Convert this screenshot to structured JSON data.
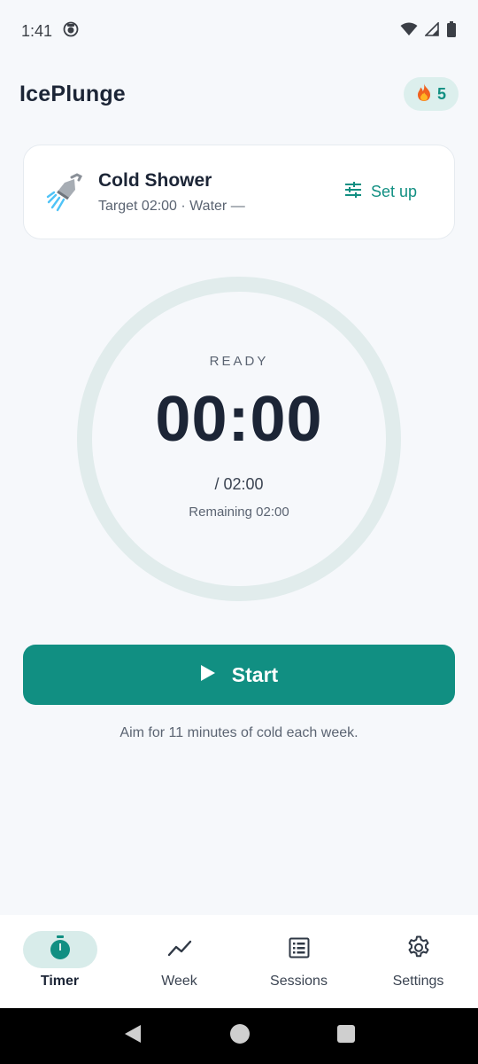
{
  "status_bar": {
    "time": "1:41",
    "icons": [
      "app-notification-icon",
      "wifi-icon",
      "signal-icon",
      "battery-icon"
    ]
  },
  "header": {
    "title": "IcePlunge",
    "streak_icon": "flame-icon",
    "streak_count": "5"
  },
  "mode_card": {
    "icon": "shower-icon",
    "title": "Cold Shower",
    "subtitle": "Target 02:00 · Water —",
    "setup_label": "Set up",
    "setup_icon": "tune-icon"
  },
  "timer": {
    "state": "READY",
    "time": "00:00",
    "target": "/ 02:00",
    "remaining": "Remaining 02:00"
  },
  "start_button": {
    "label": "Start",
    "icon": "play-icon"
  },
  "hint": "Aim for 11 minutes of cold each week.",
  "bottom_nav": {
    "items": [
      {
        "label": "Timer",
        "icon": "stopwatch-icon",
        "active": true
      },
      {
        "label": "Week",
        "icon": "trend-icon",
        "active": false
      },
      {
        "label": "Sessions",
        "icon": "list-icon",
        "active": false
      },
      {
        "label": "Settings",
        "icon": "gear-icon",
        "active": false
      }
    ]
  },
  "colors": {
    "accent": "#118f82",
    "background": "#f6f8fb",
    "ring": "#e1ecec",
    "text_primary": "#1c2536",
    "text_secondary": "#5b6472"
  }
}
